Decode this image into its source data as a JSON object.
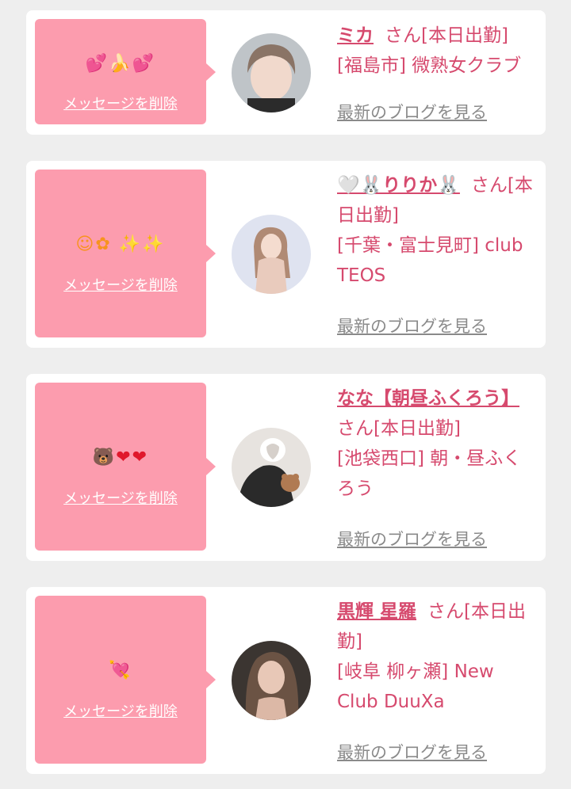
{
  "delete_label": "メッセージを削除",
  "blog_label": "最新のブログを見る",
  "accent_color": "#d64a6e",
  "bubble_color": "#fc9cae",
  "cards": [
    {
      "emojis": "💕🍌💕",
      "name": "ミカ",
      "status": "さん[本日出勤]",
      "location": "[福島市] 微熟女クラブ"
    },
    {
      "emojis": "☺✿ ✨✨",
      "name": "🤍🐰りりか🐰",
      "status": "さん[本日出勤]",
      "location": "[千葉・富士見町] club TEOS"
    },
    {
      "emojis": "🐻❤❤",
      "name": "なな【朝昼ふくろう】",
      "status": "さん[本日出勤]",
      "location": "[池袋西口] 朝・昼ふくろう"
    },
    {
      "emojis": "💘",
      "name": "黒輝 星羅",
      "status": "さん[本日出勤]",
      "location": "[岐阜 柳ヶ瀬] New Club DuuXa"
    }
  ]
}
